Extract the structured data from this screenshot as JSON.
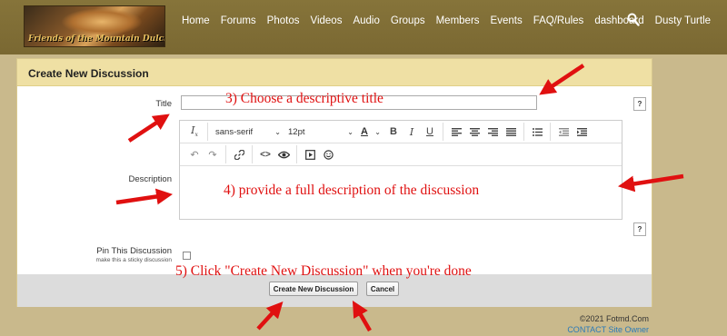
{
  "site": {
    "logo_text": "Friends of the Mountain Dulcimer"
  },
  "nav": {
    "items": [
      "Home",
      "Forums",
      "Photos",
      "Videos",
      "Audio",
      "Groups",
      "Members",
      "Events",
      "FAQ/Rules",
      "dashboard",
      "Dusty Turtle"
    ],
    "search_icon": "search-icon"
  },
  "form": {
    "header": "Create New Discussion",
    "title_label": "Title",
    "title_value": "",
    "description_label": "Description",
    "help_label": "?",
    "pin_label": "Pin This Discussion",
    "pin_sublabel": "make this a sticky discussion",
    "pin_checked": false,
    "submit_label": "Create New Discussion",
    "cancel_label": "Cancel"
  },
  "editor": {
    "font_family": "sans-serif",
    "font_size": "12pt",
    "font_color_label": "A",
    "bold": "B",
    "italic": "I",
    "underline": "U",
    "clear_format": "Ix"
  },
  "annotations": {
    "step3": "3) Choose a descriptive title",
    "step4": "4) provide a full description of the discussion",
    "step5": "5) Click \"Create New Discussion\" when you're done"
  },
  "footer": {
    "copyright": "©2021 Fotmd.Com",
    "contact": "CONTACT Site Owner"
  },
  "colors": {
    "topbar": "#7e6d35",
    "page_bg": "#c9b98c",
    "panel_header": "#efe0a4",
    "annotation": "#e01010",
    "footer_link": "#2a7ab8"
  }
}
